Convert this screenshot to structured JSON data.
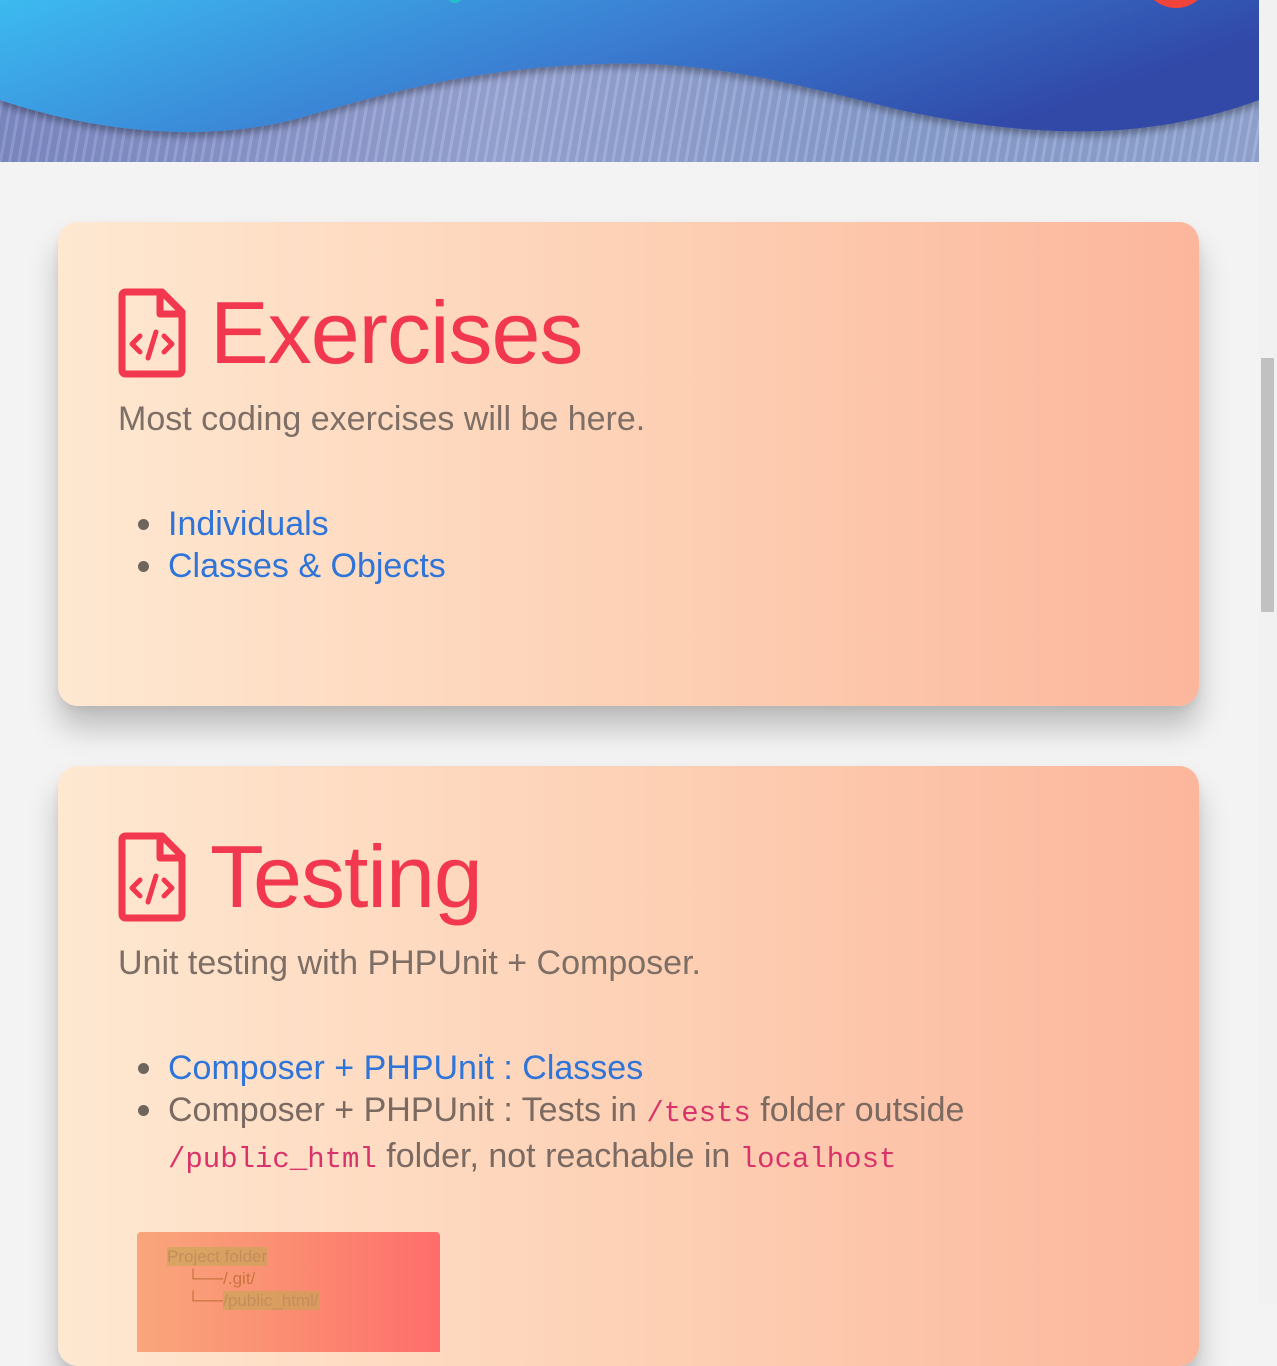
{
  "sections": [
    {
      "title": "Exercises",
      "icon": "file-code-icon",
      "subtitle": "Most coding exercises will be here.",
      "links": [
        "Individuals",
        "Classes & Objects"
      ]
    },
    {
      "title": "Testing",
      "icon": "file-code-icon",
      "subtitle": "Unit testing with PHPUnit + Composer.",
      "link": "Composer + PHPUnit : Classes",
      "tests_item": {
        "strong": "Composer + PHPUnit : Tests",
        "in": " in ",
        "tests_dir": "/tests",
        "folder_outside": " folder outside ",
        "public_dir": "/public_html",
        "not_reachable": " folder, not reachable in ",
        "host": "localhost"
      },
      "tree": {
        "root": "Project folder",
        "git": "/.git/",
        "public": "/public_html/"
      }
    }
  ],
  "colors": {
    "accent": "#f2384e",
    "link": "#2f74d8",
    "code": "#d8336a"
  }
}
